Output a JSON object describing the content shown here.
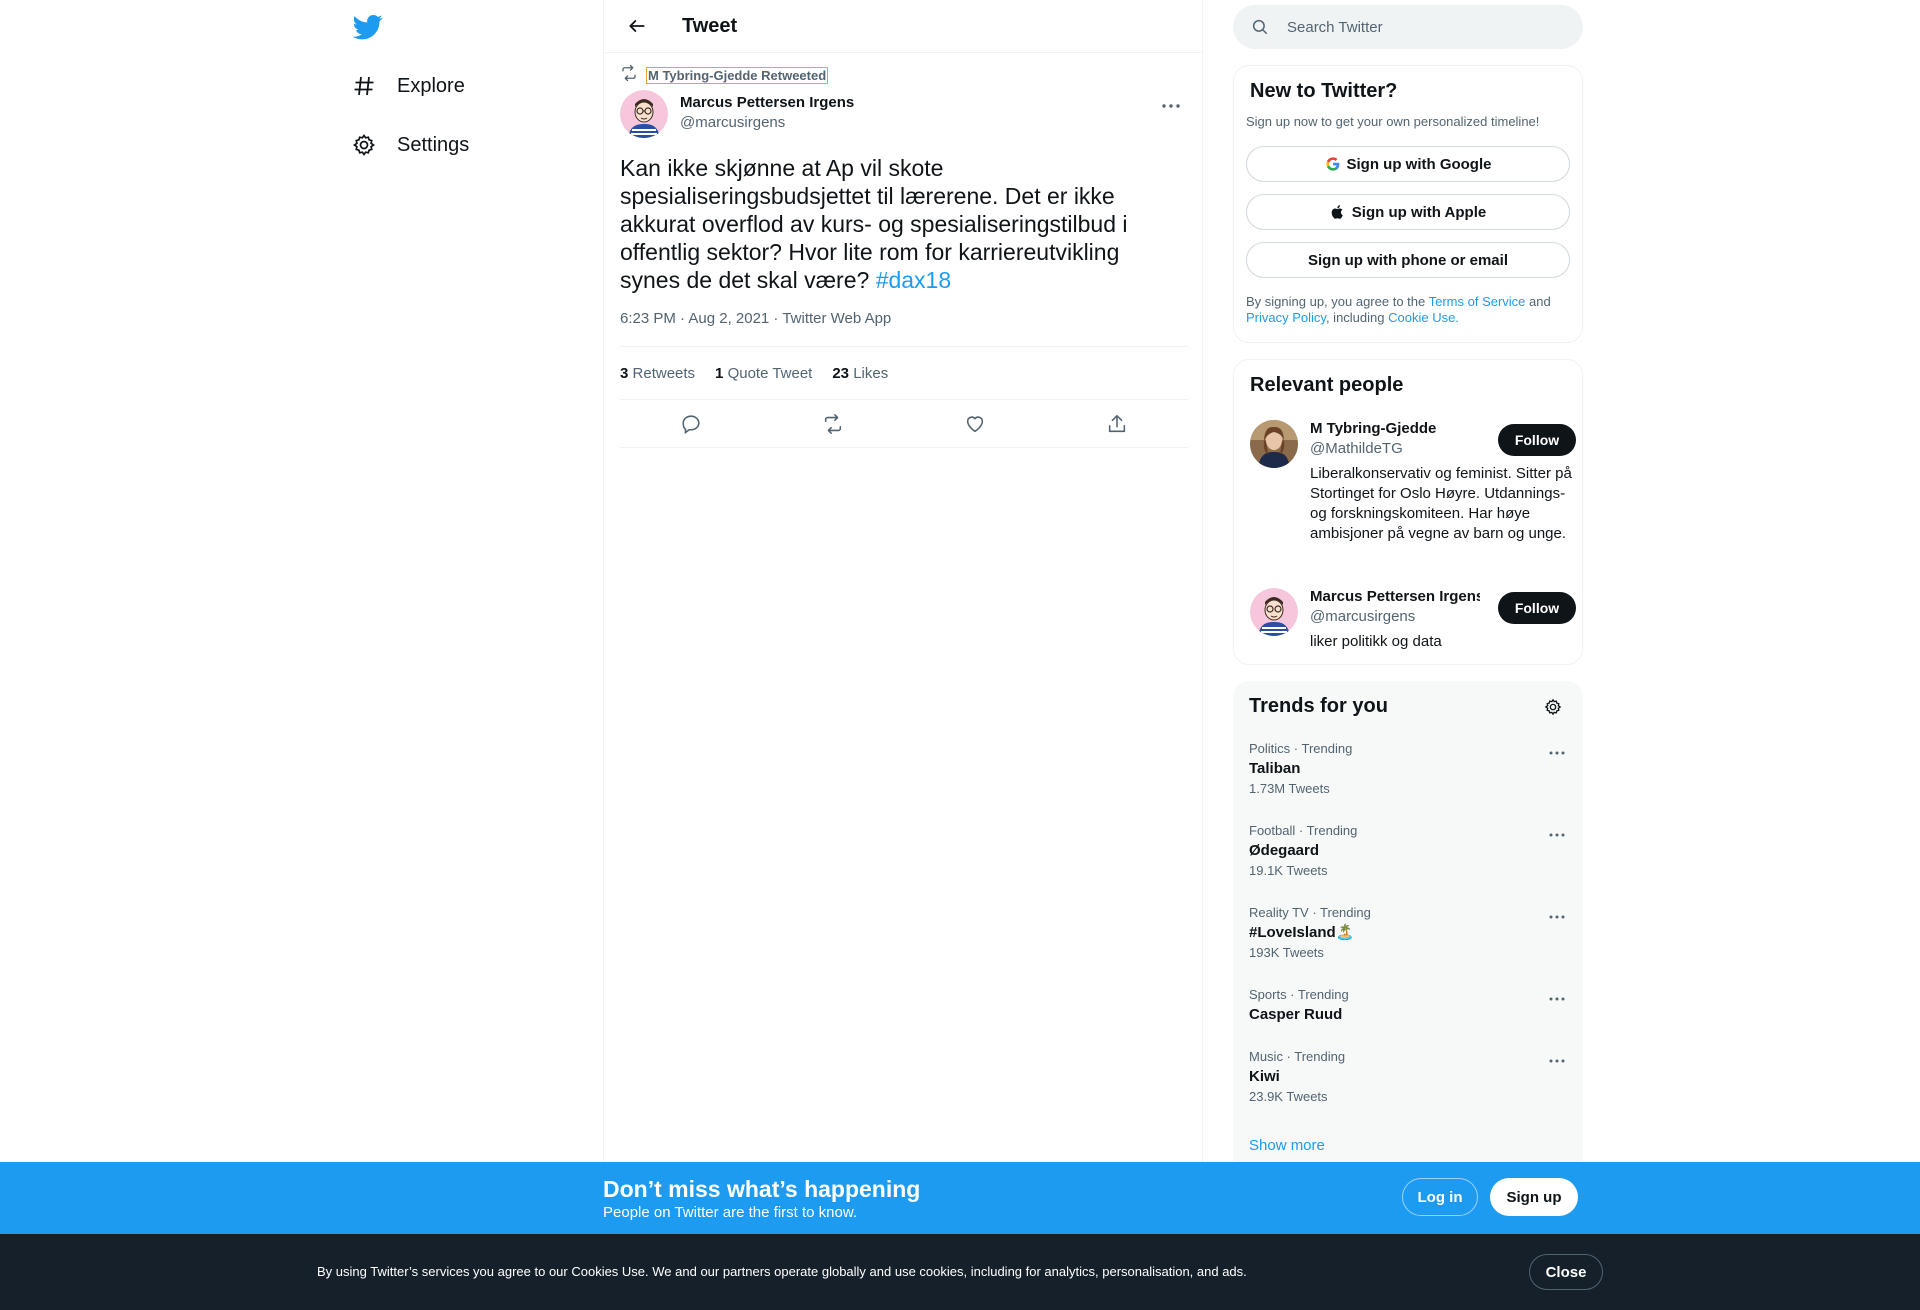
{
  "colors": {
    "accent": "#1d9bf0",
    "text": "#0f1419",
    "secondary": "#536471",
    "border": "#eff3f4",
    "dark_bar": "#15202b"
  },
  "nav": {
    "logo_icon": "twitter-bird-icon",
    "items": [
      {
        "label": "Explore",
        "icon": "hashtag-icon"
      },
      {
        "label": "Settings",
        "icon": "gear-icon"
      }
    ]
  },
  "header": {
    "back_icon": "arrow-left-icon",
    "title": "Tweet"
  },
  "tweet": {
    "retweet_context": "M Tybring-Gjedde Retweeted",
    "author_name": "Marcus Pettersen Irgens",
    "author_handle": "@marcusirgens",
    "text": "Kan ikke skjønne at Ap vil skote spesialiseringsbudsjettet til lærerene. Det er ikke akkurat overflod av kurs- og spesialiseringstilbud i offentlig sektor? Hvor lite rom for karriereutvikling synes de det skal være?",
    "hashtag": "#dax18",
    "meta": "6:23 PM · Aug 2, 2021 · Twitter Web App",
    "stats": {
      "retweets_count": "3",
      "retweets_label": "Retweets",
      "quotes_count": "1",
      "quotes_label": "Quote Tweet",
      "likes_count": "23",
      "likes_label": "Likes"
    }
  },
  "search": {
    "placeholder": "Search Twitter"
  },
  "new_to_twitter": {
    "title": "New to Twitter?",
    "subtitle": "Sign up now to get your own personalized timeline!",
    "google_label": "Sign up with Google",
    "apple_label": "Sign up with Apple",
    "phone_label": "Sign up with phone or email",
    "legal_pre": "By signing up, you agree to the ",
    "terms_link": "Terms of Service",
    "legal_and": " and ",
    "privacy_link": "Privacy Policy",
    "legal_mid": ", including ",
    "cookie_link": "Cookie Use."
  },
  "relevant_people": {
    "title": "Relevant people",
    "people": [
      {
        "name": "M Tybring-Gjedde",
        "handle": "@MathildeTG",
        "bio": "Liberalkonservativ og feminist. Sitter på Stortinget for Oslo Høyre. Utdannings- og forskningskomiteen. Har høye ambisjoner på vegne av barn og unge.",
        "follow_label": "Follow"
      },
      {
        "name": "Marcus Pettersen Irgens",
        "handle": "@marcusirgens",
        "bio": "liker politikk og data",
        "follow_label": "Follow"
      }
    ]
  },
  "trends": {
    "title": "Trends for you",
    "items": [
      {
        "context": "Politics · Trending",
        "name": "Taliban",
        "count": "1.73M Tweets"
      },
      {
        "context": "Football · Trending",
        "name": "Ødegaard",
        "count": "19.1K Tweets"
      },
      {
        "context": "Reality TV · Trending",
        "name": "#LoveIsland🏝️",
        "count": "193K Tweets"
      },
      {
        "context": "Sports · Trending",
        "name": "Casper Ruud",
        "count": ""
      },
      {
        "context": "Music · Trending",
        "name": "Kiwi",
        "count": "23.9K Tweets"
      }
    ],
    "show_more": "Show more"
  },
  "banner": {
    "title": "Don’t miss what’s happening",
    "subtitle": "People on Twitter are the first to know.",
    "login_label": "Log in",
    "signup_label": "Sign up"
  },
  "cookie_bar": {
    "text": "By using Twitter’s services you agree to our Cookies Use. We and our partners operate globally and use cookies, including for analytics, personalisation, and ads.",
    "close_label": "Close"
  }
}
